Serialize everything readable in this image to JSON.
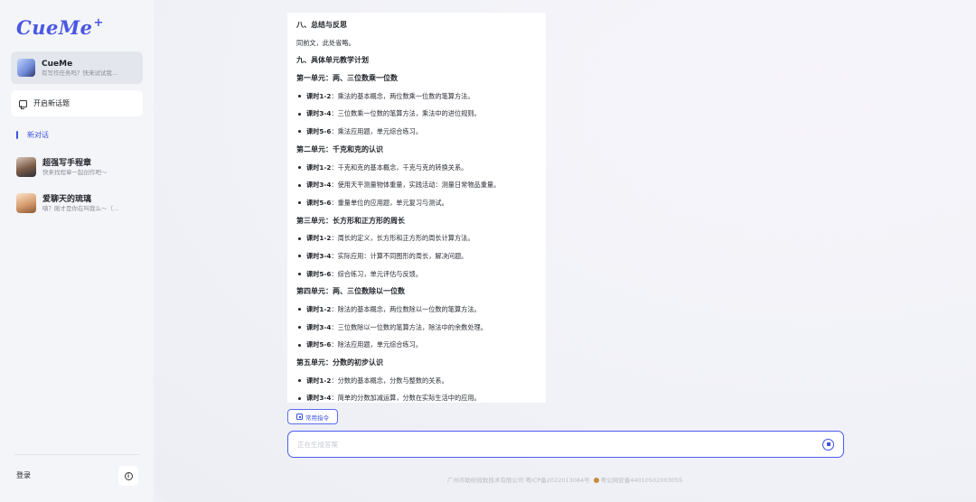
{
  "app": {
    "logo_text": "CueMe",
    "logo_plus": "+"
  },
  "sidebar": {
    "assistant": {
      "name": "CueMe",
      "subtitle": "有写作任务吗？快来试试我..."
    },
    "new_topic_label": "开启新话题",
    "new_chat_label": "新对话",
    "bots": [
      {
        "name": "超强写手程章",
        "subtitle": "快来找程章一起创作吧～"
      },
      {
        "name": "爱聊天的琉璃",
        "subtitle": "嗔？刚才是你在叫我么～（..."
      }
    ],
    "login_label": "登录",
    "icons": {
      "new_topic": "chat-bubble-icon",
      "info": "info-icon"
    }
  },
  "document": {
    "lines": [
      {
        "type": "h2",
        "text": "八、总结与反思"
      },
      {
        "type": "p",
        "text": "同前文，此处省略。"
      },
      {
        "type": "h2",
        "text": "九、具体单元教学计划"
      },
      {
        "type": "h2",
        "text": "第一单元：两、三位数乘一位数"
      },
      {
        "type": "li",
        "strong": "课时1-2",
        "text": "：乘法的基本概念，两位数乘一位数的笔算方法。"
      },
      {
        "type": "li",
        "strong": "课时3-4",
        "text": "：三位数乘一位数的笔算方法，乘法中的进位规则。"
      },
      {
        "type": "li",
        "strong": "课时5-6",
        "text": "：乘法应用题，单元综合练习。"
      },
      {
        "type": "h2",
        "text": "第二单元：千克和克的认识"
      },
      {
        "type": "li",
        "strong": "课时1-2",
        "text": "：千克和克的基本概念，千克与克的转换关系。"
      },
      {
        "type": "li",
        "strong": "课时3-4",
        "text": "：使用天平测量物体重量，实践活动：测量日常物品重量。"
      },
      {
        "type": "li",
        "strong": "课时5-6",
        "text": "：重量单位的应用题，单元复习与测试。"
      },
      {
        "type": "h2",
        "text": "第三单元：长方形和正方形的周长"
      },
      {
        "type": "li",
        "strong": "课时1-2",
        "text": "：周长的定义，长方形和正方形的周长计算方法。"
      },
      {
        "type": "li",
        "strong": "课时3-4",
        "text": "：实际应用：计算不同图形的周长，解决问题。"
      },
      {
        "type": "li",
        "strong": "课时5-6",
        "text": "：综合练习，单元评估与反馈。"
      },
      {
        "type": "h2",
        "text": "第四单元：两、三位数除以一位数"
      },
      {
        "type": "li",
        "strong": "课时1-2",
        "text": "：除法的基本概念，两位数除以一位数的笔算方法。"
      },
      {
        "type": "li",
        "strong": "课时3-4",
        "text": "：三位数除以一位数的笔算方法，除法中的余数处理。"
      },
      {
        "type": "li",
        "strong": "课时5-6",
        "text": "：除法应用题，单元综合练习。"
      },
      {
        "type": "h2",
        "text": "第五单元：分数的初步认识"
      },
      {
        "type": "li",
        "strong": "课时1-2",
        "text": "：分数的基本概念，分数与整数的关系。"
      },
      {
        "type": "li",
        "strong": "课时3-4",
        "text": "：简单的分数加减运算，分数在实际生活中的应用。"
      }
    ]
  },
  "composer": {
    "common_commands_label": "常用指令",
    "input_placeholder": "正在生成答案",
    "input_value": "",
    "icons": {
      "commands": "command-icon",
      "stop": "stop-generating-icon"
    }
  },
  "footer": {
    "company_icp": "广州市助纷微数技术有限公司 粤ICP备2022013084号",
    "police_record": "粤公网安备44010502003055"
  },
  "colors": {
    "accent": "#3b53e0",
    "logo": "#4a56e2",
    "sidebar_bg": "#f4f5f8"
  }
}
